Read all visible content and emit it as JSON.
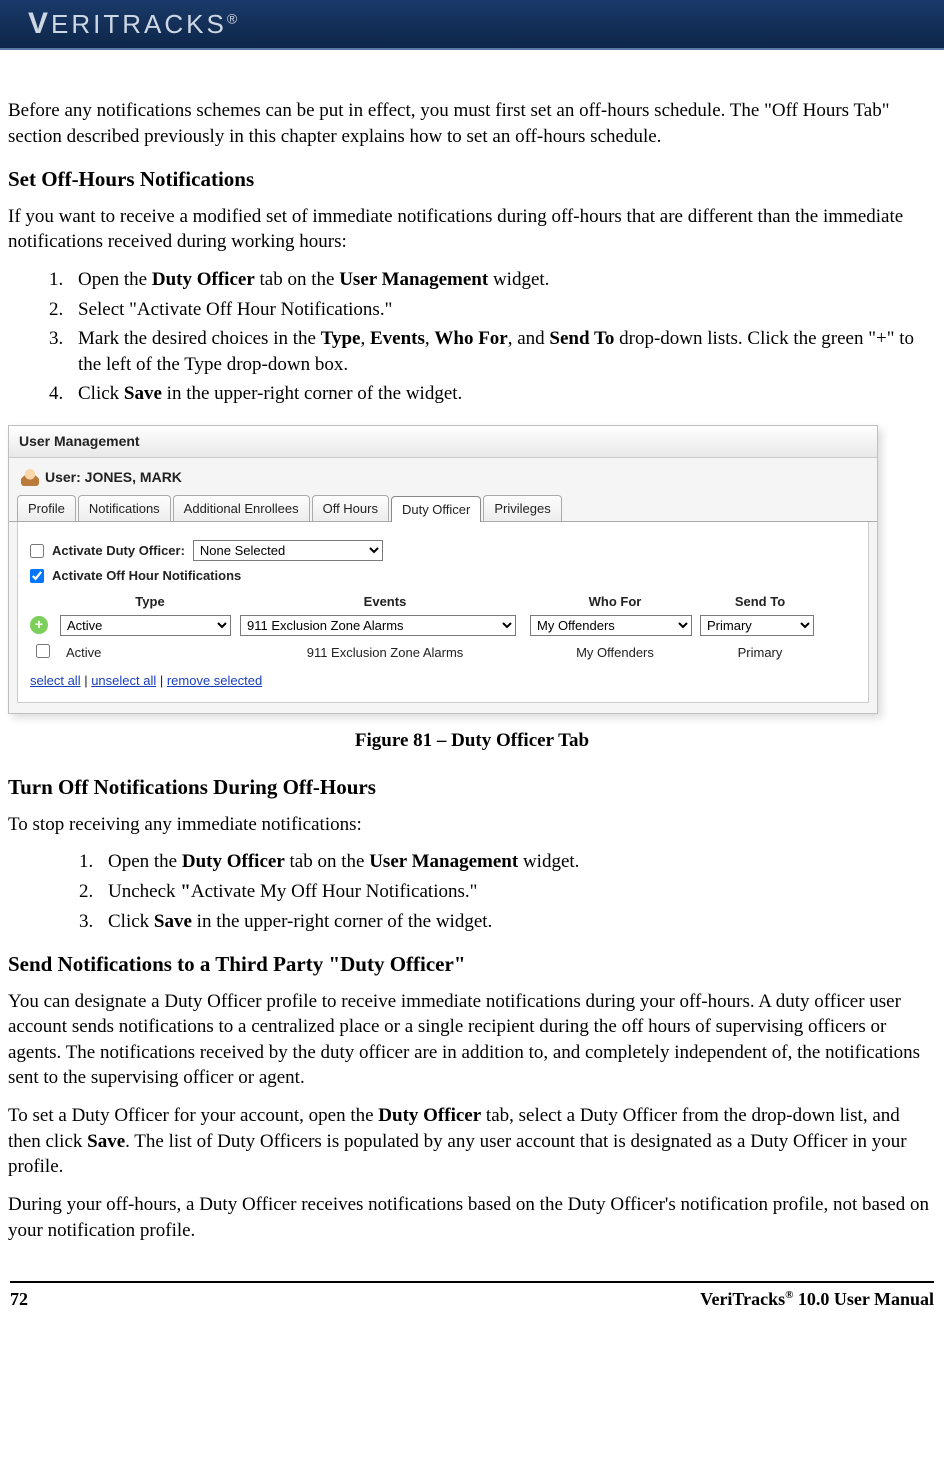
{
  "header": {
    "logo_text": "VERITRACKS",
    "reg": "®"
  },
  "intro": "Before any notifications schemes can be put in effect, you must first set an off-hours schedule. The \"Off Hours Tab\" section described previously in this chapter explains how to set an off-hours schedule.",
  "section1": {
    "heading": "Set Off-Hours Notifications",
    "lead": "If you want to receive a modified set of immediate notifications during off-hours that are different than the immediate notifications received during working hours:",
    "steps": {
      "s1a": "Open the ",
      "s1b": "Duty Officer",
      "s1c": " tab on the ",
      "s1d": "User Management",
      "s1e": " widget.",
      "s2": "Select \"Activate Off Hour Notifications.\"",
      "s3a": "Mark the desired choices in the ",
      "s3b": "Type",
      "s3c": ", ",
      "s3d": "Events",
      "s3e": ", ",
      "s3f": "Who For",
      "s3g": ", and ",
      "s3h": "Send To",
      "s3i": " drop-down lists. Click the green \"+\" to the left of the Type drop-down box.",
      "s4a": "Click ",
      "s4b": "Save",
      "s4c": " in the upper-right corner of the widget."
    }
  },
  "widget": {
    "title": "User Management",
    "user_label": "User: JONES, MARK",
    "tabs": [
      "Profile",
      "Notifications",
      "Additional Enrollees",
      "Off Hours",
      "Duty Officer",
      "Privileges"
    ],
    "activate_duty_label": "Activate Duty Officer:",
    "activate_duty_value": "None Selected",
    "activate_offhour_label": "Activate Off Hour Notifications",
    "cols": [
      "Type",
      "Events",
      "Who For",
      "Send To"
    ],
    "type_opt": "Active",
    "events_opt": "911 Exclusion Zone Alarms",
    "whofor_opt": "My Offenders",
    "sendto_opt": "Primary",
    "row2": {
      "type": "Active",
      "events": "911 Exclusion Zone Alarms",
      "whofor": "My Offenders",
      "sendto": "Primary"
    },
    "links": {
      "select_all": "select all",
      "unselect_all": "unselect all",
      "remove": "remove selected",
      "sep": " | "
    }
  },
  "figure_caption": "Figure 81 – Duty Officer Tab",
  "section2": {
    "heading": "Turn Off Notifications During Off-Hours",
    "lead": "To stop receiving any immediate notifications:",
    "steps": {
      "s1a": "Open the ",
      "s1b": "Duty Officer",
      "s1c": " tab on the ",
      "s1d": "User Management",
      "s1e": " widget.",
      "s2a": "Uncheck ",
      "s2b": "\"",
      "s2c": "Activate My Off Hour Notifications.\"",
      "s3a": "Click ",
      "s3b": "Save",
      "s3c": " in the upper-right corner of the widget."
    }
  },
  "section3": {
    "heading": "Send Notifications to a Third Party \"Duty Officer\"",
    "p1": "You can designate a Duty Officer profile to receive immediate notifications during your off-hours. A duty officer user account sends notifications to a centralized place or a single recipient during the off hours of supervising officers or agents. The notifications received by the duty officer are in addition to, and completely independent of, the notifications sent to the supervising officer or agent.",
    "p2a": "To set a Duty Officer for your account, open the ",
    "p2b": "Duty Officer",
    "p2c": " tab, select a Duty Officer from the drop-down list, and then click ",
    "p2d": "Save",
    "p2e": ". The list of Duty Officers is populated by any user account that is designated as a Duty Officer in your profile.",
    "p3": "During your off-hours, a Duty Officer receives notifications based on the Duty Officer's notification profile, not based on your notification profile."
  },
  "footer": {
    "page": "72",
    "title_a": "VeriTracks",
    "title_sup": "®",
    "title_b": " 10.0 User Manual"
  }
}
